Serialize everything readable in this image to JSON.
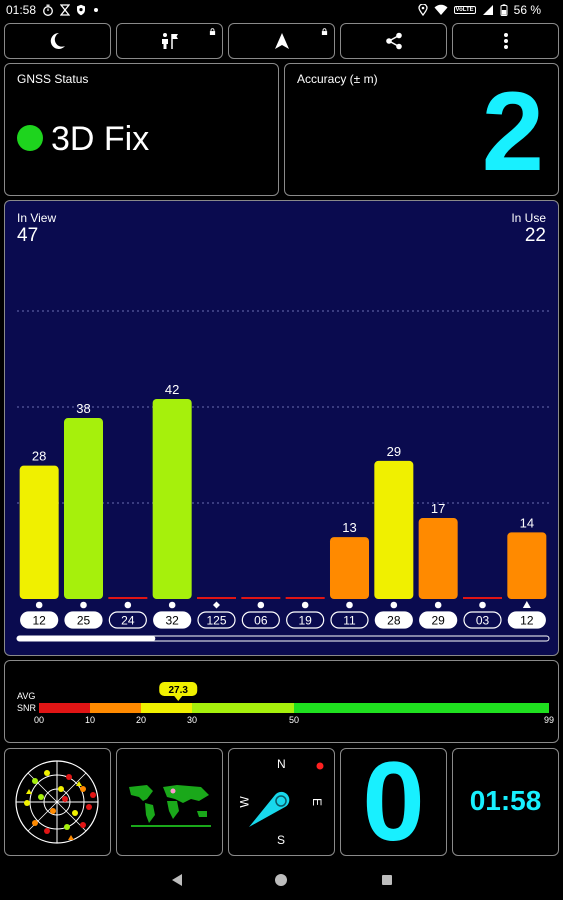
{
  "status_bar": {
    "time": "01:58",
    "battery": "56 %",
    "volte": "VoLTE",
    "left_icons": [
      "stopwatch-icon",
      "hourglass-icon",
      "shield-icon",
      "dot-icon"
    ],
    "right_icons": [
      "location-icon",
      "wifi-icon",
      "signal-icon",
      "battery-icon"
    ]
  },
  "toolbar": {
    "buttons": [
      {
        "icon": "moon-icon",
        "locked": false
      },
      {
        "icon": "flag-person-icon",
        "locked": true
      },
      {
        "icon": "navigation-arrow-icon",
        "locked": true
      },
      {
        "icon": "share-icon",
        "locked": false
      },
      {
        "icon": "more-vertical-icon",
        "locked": false
      }
    ]
  },
  "gnss_status": {
    "label": "GNSS Status",
    "fix": "3D Fix",
    "fix_color": "#1ed41e"
  },
  "accuracy": {
    "label": "Accuracy (± m)",
    "value": "2"
  },
  "satellites": {
    "in_view_label": "In View",
    "in_view": "47",
    "in_use_label": "In Use",
    "in_use": "22",
    "scroll_fraction": 0.26
  },
  "chart_data": {
    "type": "bar",
    "categories": [
      "12",
      "25",
      "24",
      "32",
      "125",
      "06",
      "19",
      "11",
      "28",
      "29",
      "03",
      "12"
    ],
    "values": [
      28,
      38,
      0,
      42,
      0,
      0,
      0,
      13,
      29,
      17,
      0,
      14
    ],
    "constellation_markers": [
      "circle",
      "circle",
      "circle",
      "circle",
      "diamond",
      "circle",
      "circle",
      "circle",
      "circle",
      "circle",
      "circle",
      "triangle"
    ],
    "used_in_fix": [
      true,
      true,
      false,
      true,
      false,
      false,
      false,
      false,
      true,
      true,
      false,
      true
    ],
    "ylim": [
      0,
      50
    ],
    "grid": true,
    "colors": {
      "high": "#a6f00c",
      "mid": "#f0f000",
      "low": "#ff8a00",
      "none": "#e01515"
    }
  },
  "snr": {
    "avg_label": "AVG",
    "snr_label": "SNR",
    "avg_value": "27.3",
    "avg": 27.3,
    "ticks": [
      "00",
      "10",
      "20",
      "30",
      "50",
      "99"
    ],
    "segments": [
      {
        "from": 0,
        "to": 10,
        "color": "#e01515"
      },
      {
        "from": 10,
        "to": 20,
        "color": "#ff8a00"
      },
      {
        "from": 20,
        "to": 30,
        "color": "#f0f000"
      },
      {
        "from": 30,
        "to": 50,
        "color": "#a6f00c"
      },
      {
        "from": 50,
        "to": 99,
        "color": "#1fe01f"
      }
    ]
  },
  "bottom": {
    "sky_icon": "sky-plot-icon",
    "map_icon": "world-map-icon",
    "compass": {
      "n": "N",
      "e": "E",
      "s": "S",
      "w": "W"
    },
    "speed": "0",
    "clock": "01:58"
  },
  "nav": {
    "back_icon": "back-icon",
    "home_icon": "home-icon",
    "recents_icon": "recents-icon"
  }
}
